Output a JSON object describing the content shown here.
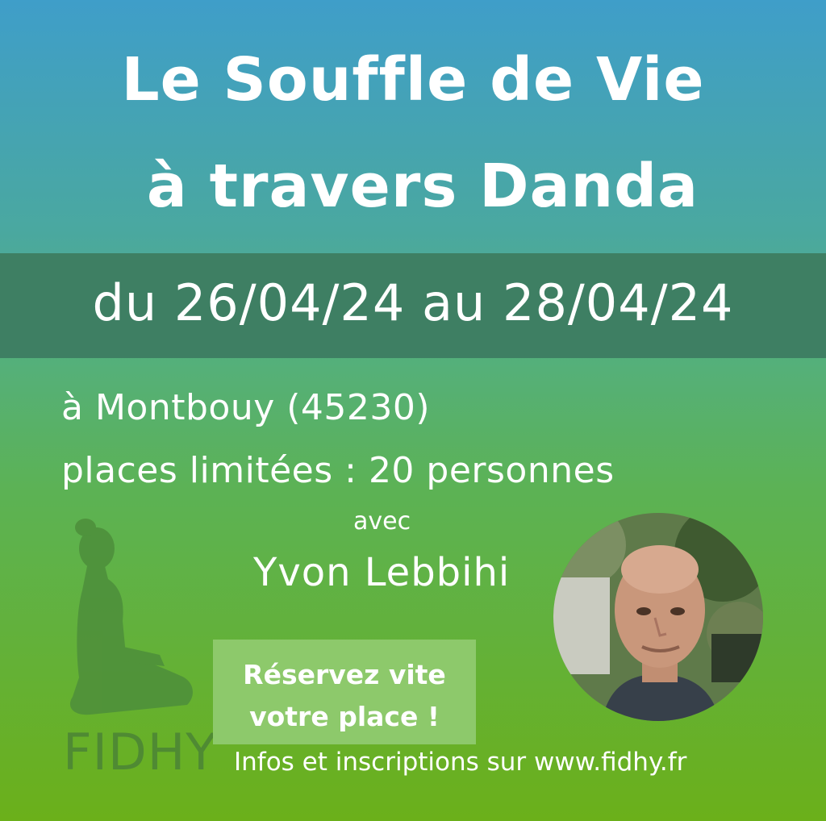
{
  "title": {
    "line1": "Le Souffle de Vie",
    "line2": "à travers Danda"
  },
  "dates": "du 26/04/24 au 28/04/24",
  "location": "à Montbouy (45230)",
  "places": "places limitées : 20 personnes",
  "with_label": "avec",
  "host_name": "Yvon Lebbihi",
  "cta": {
    "line1": "Réservez vite",
    "line2": "votre place !"
  },
  "infos": "Infos et inscriptions sur www.fidhy.fr",
  "logo_text": "FIDHY",
  "icons": {
    "silhouette": "meditating-person-icon",
    "portrait": "host-portrait-photo"
  },
  "colors": {
    "top": "#3f9ec9",
    "band": "#3e7f63",
    "bottom": "#6bb01a",
    "cta": "#8dc96b",
    "logo": "#4f8a33"
  }
}
